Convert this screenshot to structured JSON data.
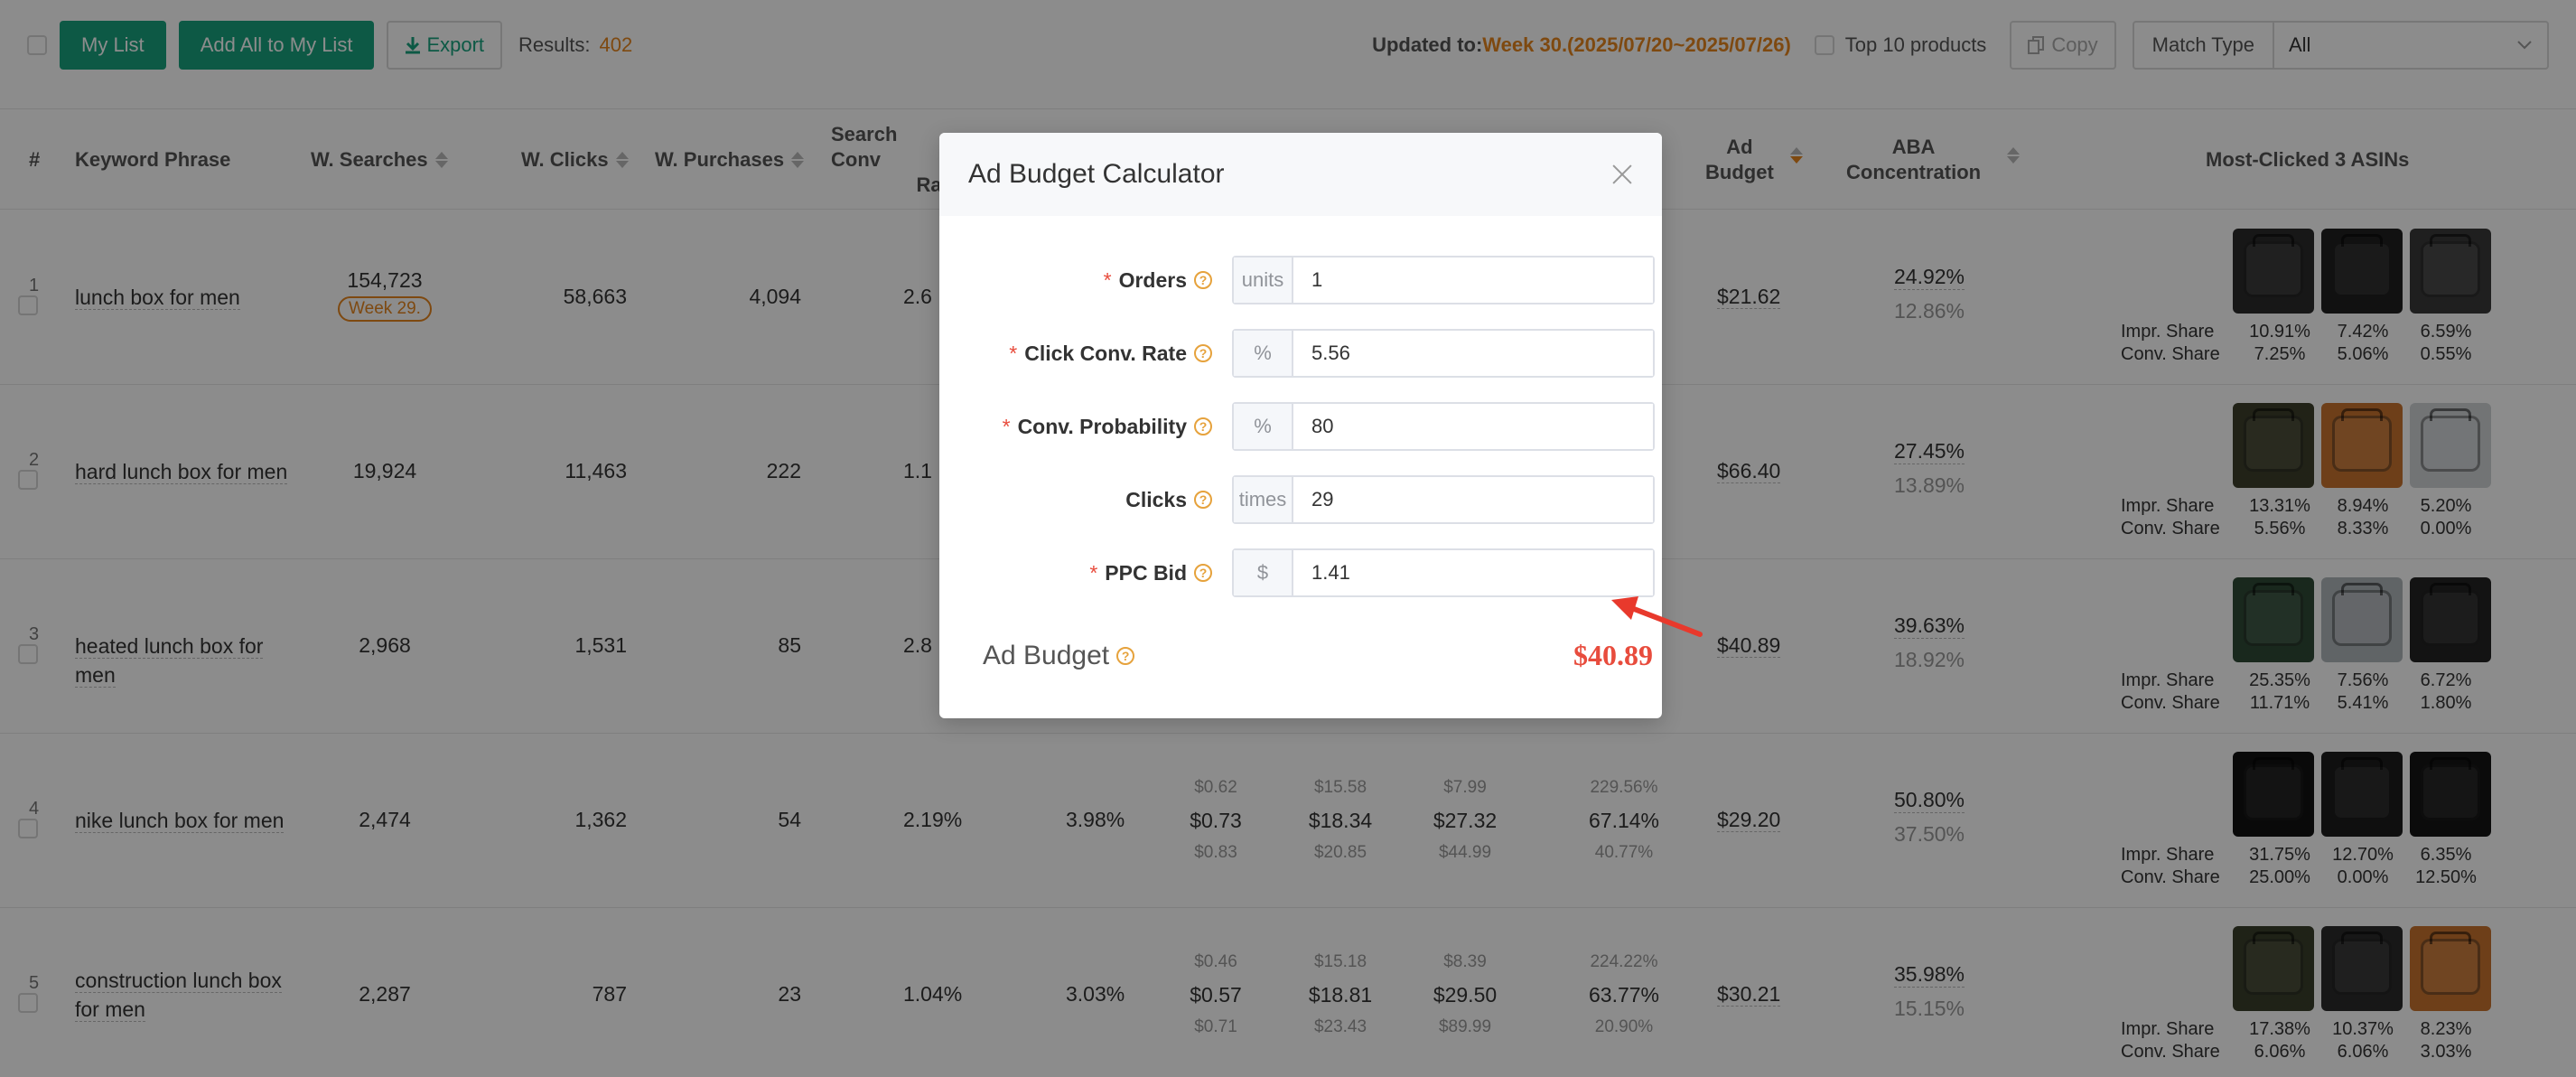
{
  "toolbar": {
    "my_list": "My List",
    "add_all": "Add All to My List",
    "export": "Export",
    "results_label": "Results:",
    "results_count": "402",
    "updated_label": "Updated to:",
    "updated_value": "Week 30.(2025/07/20~2025/07/26)",
    "top10": "Top 10 products",
    "copy": "Copy",
    "match_type_label": "Match Type",
    "match_type_value": "All"
  },
  "columns": {
    "idx": "#",
    "keyword": "Keyword Phrase",
    "searches": "W. Searches",
    "clicks": "W. Clicks",
    "purchases": "W. Purchases",
    "search_conv_1": "Search Conv",
    "search_conv_2": "Rat",
    "ad_budget_1": "Ad",
    "ad_budget_2": "Budget",
    "aba_1": "ABA",
    "aba_2": "Concentration",
    "asins": "Most-Clicked 3 ASINs"
  },
  "share_labels": {
    "impr": "Impr. Share",
    "conv": "Conv. Share"
  },
  "rows": [
    {
      "idx": "1",
      "keyword": "lunch box for men",
      "searches": "154,723",
      "week_tag": "Week 29.",
      "clicks": "58,663",
      "purchases": "4,094",
      "conv": "2.6",
      "conv2": "",
      "extra": null,
      "budget": "$21.62",
      "aba1": "24.92%",
      "aba2": "12.86%",
      "impr": [
        "10.91%",
        "7.42%",
        "6.59%"
      ],
      "convs": [
        "7.25%",
        "5.06%",
        "0.55%"
      ]
    },
    {
      "idx": "2",
      "keyword": "hard lunch box for men",
      "searches": "19,924",
      "week_tag": "",
      "clicks": "11,463",
      "purchases": "222",
      "conv": "1.1",
      "conv2": "",
      "extra": null,
      "budget": "$66.40",
      "aba1": "27.45%",
      "aba2": "13.89%",
      "impr": [
        "13.31%",
        "8.94%",
        "5.20%"
      ],
      "convs": [
        "5.56%",
        "8.33%",
        "0.00%"
      ]
    },
    {
      "idx": "3",
      "keyword": "heated lunch box for men",
      "searches": "2,968",
      "week_tag": "",
      "clicks": "1,531",
      "purchases": "85",
      "conv": "2.8",
      "conv2": "",
      "extra": null,
      "budget": "$40.89",
      "aba1": "39.63%",
      "aba2": "18.92%",
      "impr": [
        "25.35%",
        "7.56%",
        "6.72%"
      ],
      "convs": [
        "11.71%",
        "5.41%",
        "1.80%"
      ]
    },
    {
      "idx": "4",
      "keyword": "nike lunch box for men",
      "searches": "2,474",
      "week_tag": "",
      "clicks": "1,362",
      "purchases": "54",
      "conv": "2.19%",
      "conv2": "3.98%",
      "extra": {
        "c1": [
          "$0.62",
          "$0.73",
          "$0.83"
        ],
        "c2": [
          "$15.58",
          "$18.34",
          "$20.85"
        ],
        "c3": [
          "$7.99",
          "$27.32",
          "$44.99"
        ],
        "c4": [
          "229.56%",
          "67.14%",
          "40.77%"
        ]
      },
      "budget": "$29.20",
      "aba1": "50.80%",
      "aba2": "37.50%",
      "impr": [
        "31.75%",
        "12.70%",
        "6.35%"
      ],
      "convs": [
        "25.00%",
        "0.00%",
        "12.50%"
      ]
    },
    {
      "idx": "5",
      "keyword": "construction lunch box for men",
      "searches": "2,287",
      "week_tag": "",
      "clicks": "787",
      "purchases": "23",
      "conv": "1.04%",
      "conv2": "3.03%",
      "extra": {
        "c1": [
          "$0.46",
          "$0.57",
          "$0.71"
        ],
        "c2": [
          "$15.18",
          "$18.81",
          "$23.43"
        ],
        "c3": [
          "$8.39",
          "$29.50",
          "$89.99"
        ],
        "c4": [
          "224.22%",
          "63.77%",
          "20.90%"
        ]
      },
      "budget": "$30.21",
      "aba1": "35.98%",
      "aba2": "15.15%",
      "impr": [
        "17.38%",
        "10.37%",
        "8.23%"
      ],
      "convs": [
        "6.06%",
        "6.06%",
        "3.03%"
      ]
    }
  ],
  "modal": {
    "title": "Ad Budget Calculator",
    "fields": [
      {
        "label": "Orders",
        "required": true,
        "unit": "units",
        "value": "1"
      },
      {
        "label": "Click Conv. Rate",
        "required": true,
        "unit": "%",
        "value": "5.56"
      },
      {
        "label": "Conv. Probability",
        "required": true,
        "unit": "%",
        "value": "80"
      },
      {
        "label": "Clicks",
        "required": false,
        "unit": "times",
        "value": "29"
      },
      {
        "label": "PPC Bid",
        "required": true,
        "unit": "$",
        "value": "1.41"
      }
    ],
    "result_label": "Ad Budget",
    "result_value": "$40.89"
  },
  "colors": {
    "accent": "#18a37f",
    "orange": "#e6851e",
    "red": "#e84c3d",
    "arrow": "#e8392c"
  },
  "icons": {
    "close": "close-icon",
    "help": "help-icon",
    "export": "download-icon",
    "copy": "copy-icon",
    "dropdown": "chevron-down-icon"
  }
}
